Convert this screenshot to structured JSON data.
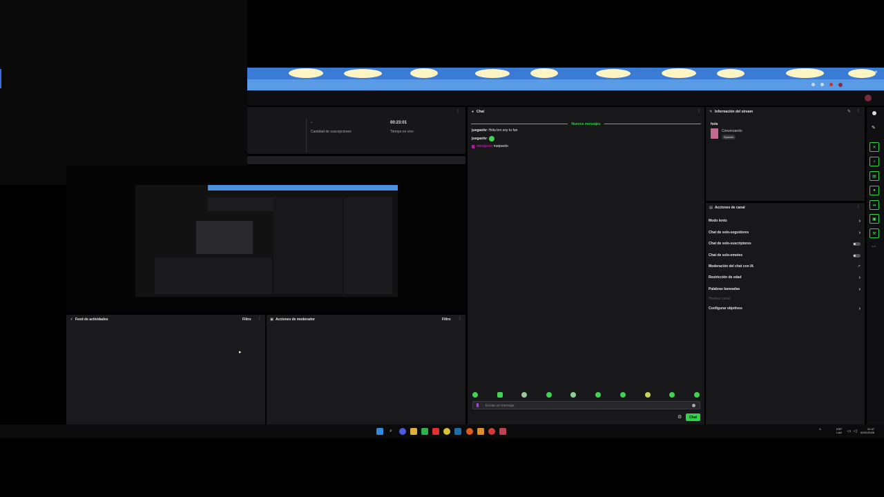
{
  "stats": {
    "subs_value": "-",
    "subs_label": "Cantidad de suscripciones",
    "time_value": "00:23:01",
    "time_label": "Tiempo en vivo"
  },
  "chat": {
    "title": "Chat",
    "new_messages": "Nuevos mensajes",
    "messages": [
      {
        "user": "juegastiv",
        "text": ": Hola bro soy tu fan"
      },
      {
        "user": "juegastiv",
        "text": ":"
      },
      {
        "user": "stengiuis",
        "text": ": matpardo"
      }
    ],
    "input_placeholder": "Enviar un mensaje",
    "send_label": "Chat",
    "colors": {
      "accent": "#2fd44a",
      "user_highlight": "#b21f9a"
    }
  },
  "stream_info": {
    "title": "Información del stream",
    "stream_title": "hola",
    "category": "Conversando",
    "tag": "Spanish"
  },
  "channel_actions": {
    "title": "Acciones de canal",
    "items": [
      {
        "label": "Modo lento",
        "control": "chevron"
      },
      {
        "label": "Chat de solo-seguidores",
        "control": "chevron"
      },
      {
        "label": "Chat de solo-suscriptores",
        "control": "toggle"
      },
      {
        "label": "Chat de solo-emotes",
        "control": "toggle"
      },
      {
        "label": "Moderación del chat con IA",
        "control": "external"
      },
      {
        "label": "Restricción de edad",
        "control": "chevron"
      },
      {
        "label": "Palabras baneadas",
        "control": "chevron"
      },
      {
        "label": "Hostear canal",
        "control": "none"
      },
      {
        "label": "Configurar objetivos",
        "control": "chevron"
      }
    ]
  },
  "activity_feed": {
    "title": "Feed de actividades",
    "filter": "Filtro"
  },
  "mod_actions": {
    "title": "Acciones de moderador",
    "filter": "Filtro"
  },
  "taskbar": {
    "lang_top": "ESP",
    "lang_bottom": "LAA",
    "time": "22:47",
    "date": "02/01/2026"
  }
}
